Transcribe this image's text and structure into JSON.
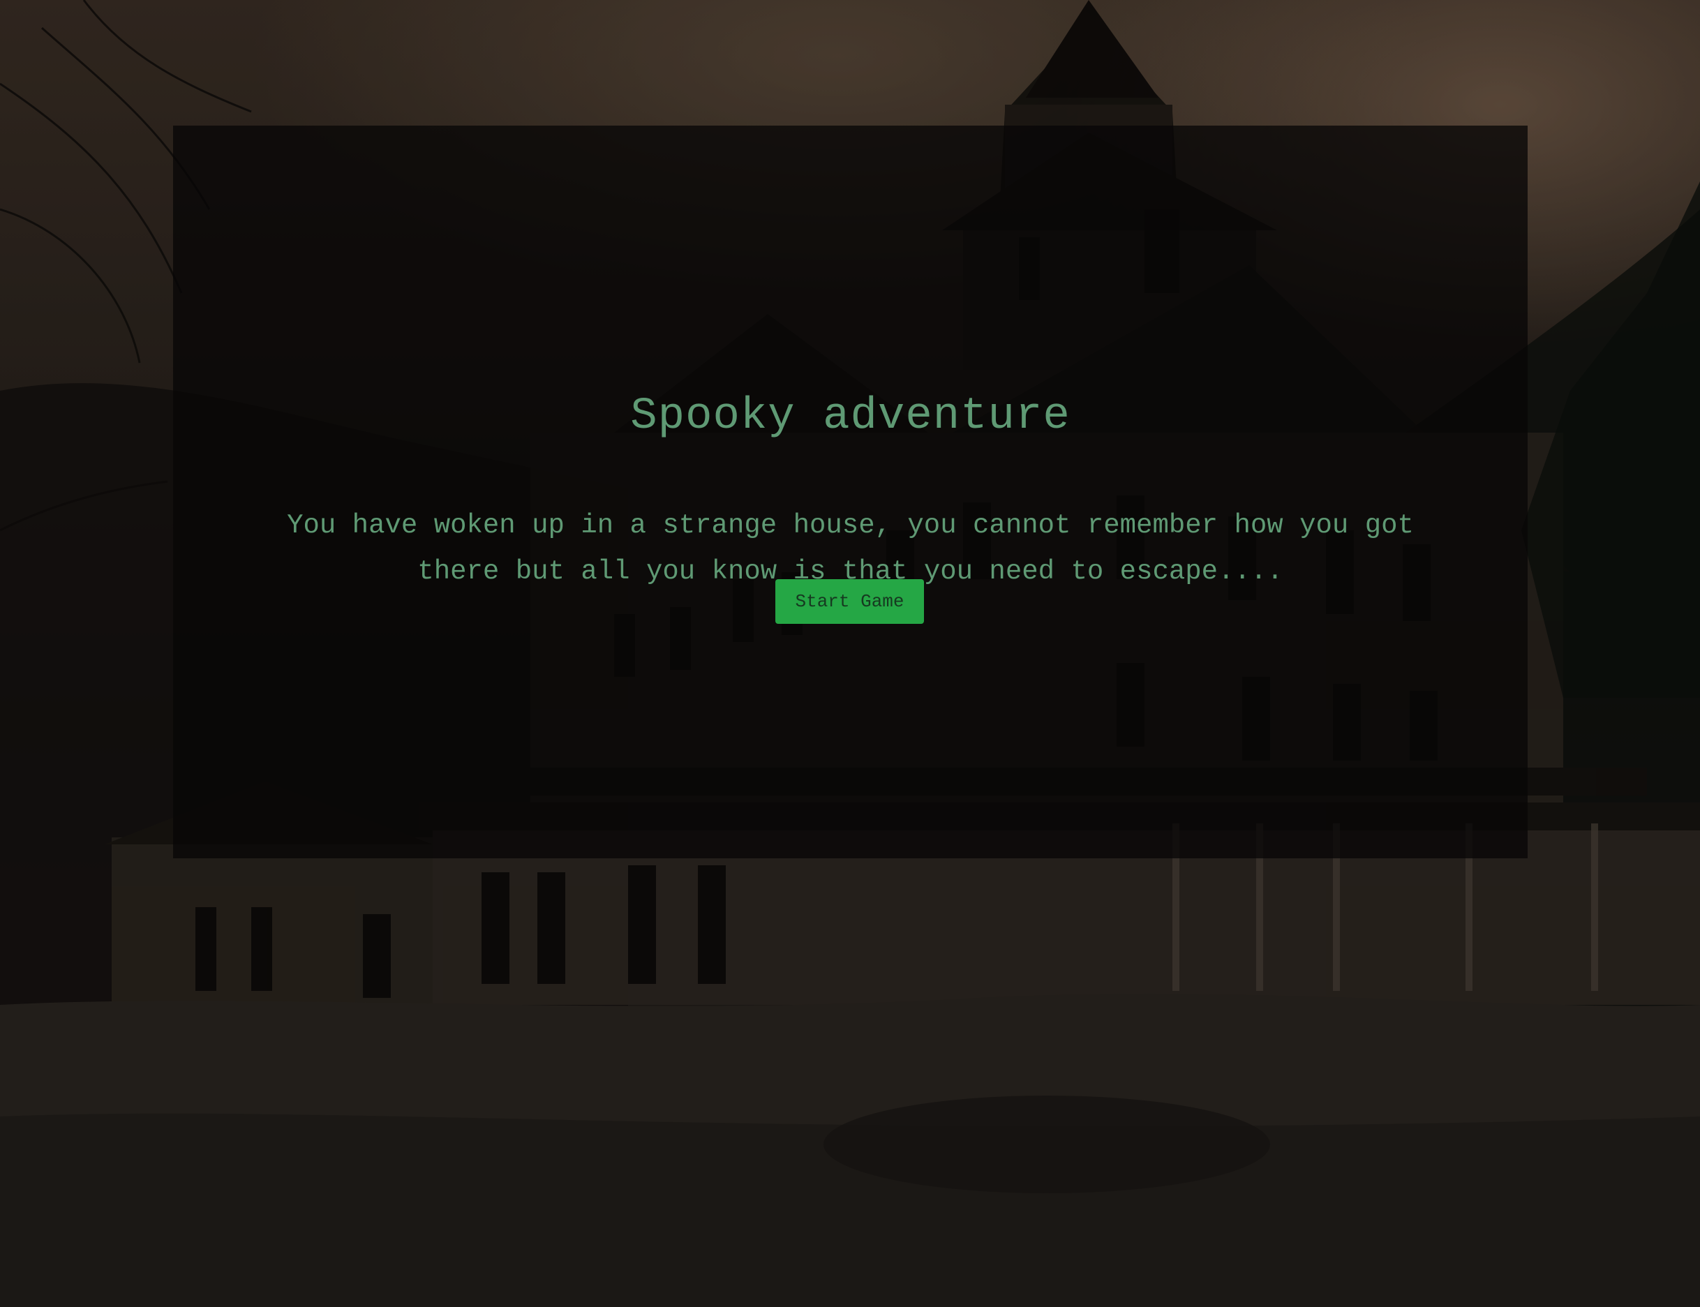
{
  "game": {
    "title": "Spooky adventure",
    "intro": "You have woken up in a strange house, you cannot remember how you got there but all you know is that you need to escape....",
    "start_button_label": "Start Game"
  },
  "theme": {
    "text_color": "#5f9a74",
    "button_color": "#25a745",
    "button_text_color": "#163a20",
    "panel_color": "#080706"
  },
  "background": {
    "image": "haunted-house-photo"
  }
}
